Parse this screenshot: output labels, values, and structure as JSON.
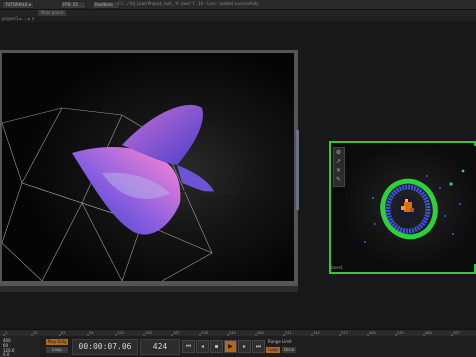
{
  "topbar": {
    "tabs": [
      {
        "label": "TUTORIALS ▾"
      },
      {
        "label": "FPS: 55"
      },
      {
        "label": "Realtime"
      }
    ],
    "info": "C:/.../ 04_Load Project, last_ 'A' Geo? 'I'. 16 - Line - loaded successfully"
  },
  "secondbar": {
    "label": "Main panel"
  },
  "thirdbar": {
    "label": "project1 ▸ ... ▸ ✕"
  },
  "node2": {
    "label": "base1"
  },
  "timeline": {
    "ruler_ticks": [
      "1",
      "32",
      "63",
      "94",
      "125",
      "156",
      "187",
      "218",
      "249",
      "280",
      "311",
      "342",
      "373",
      "404",
      "435",
      "466",
      "497"
    ],
    "play_mode": "Play Only",
    "loop_label": "Loop",
    "timecode": "00:00:07.06",
    "frame": "424",
    "range_label": "Range Limit",
    "range_on": "Loop",
    "range_off": "Once"
  },
  "stats": [
    "400",
    "60",
    "120.0",
    "0.0"
  ],
  "colors": {
    "node_select": "#39c43a",
    "accent": "#b06a1c",
    "ring_green": "#2fd13a",
    "ring_blue": "#3f52e8"
  }
}
